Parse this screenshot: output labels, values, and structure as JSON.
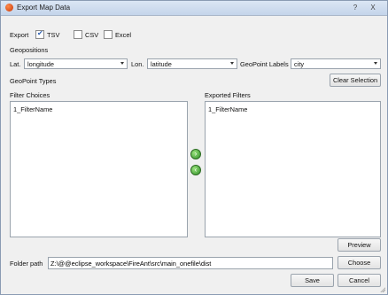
{
  "window": {
    "title": "Export Map Data",
    "help_glyph": "?",
    "close_glyph": "X"
  },
  "export": {
    "label": "Export",
    "tsv_label": "TSV",
    "tsv_checked": true,
    "csv_label": "CSV",
    "csv_checked": false,
    "excel_label": "Excel",
    "excel_checked": false
  },
  "geopositions": {
    "heading": "Geopositions",
    "lat_label": "Lat.",
    "lat_value": "longitude",
    "lon_label": "Lon.",
    "lon_value": "latitude",
    "labels_label": "GeoPoint Labels",
    "labels_value": "city"
  },
  "geopoint_types": {
    "heading": "GeoPoint Types",
    "clear_selection_label": "Clear Selection"
  },
  "filters": {
    "choices_heading": "Filter Choices",
    "choices_items": [
      "1_FilterName"
    ],
    "exported_heading": "Exported Filters",
    "exported_items": [
      "1_FilterName"
    ]
  },
  "actions": {
    "preview_label": "Preview",
    "folder_path_label": "Folder path",
    "folder_path_value": "Z:\\@@eclipse_workspace\\FireAnt\\src\\main_onefile\\dist",
    "choose_label": "Choose",
    "save_label": "Save",
    "cancel_label": "Cancel"
  },
  "colors": {
    "accent_green": "#2e8f28",
    "check_blue": "#2a5db0"
  }
}
